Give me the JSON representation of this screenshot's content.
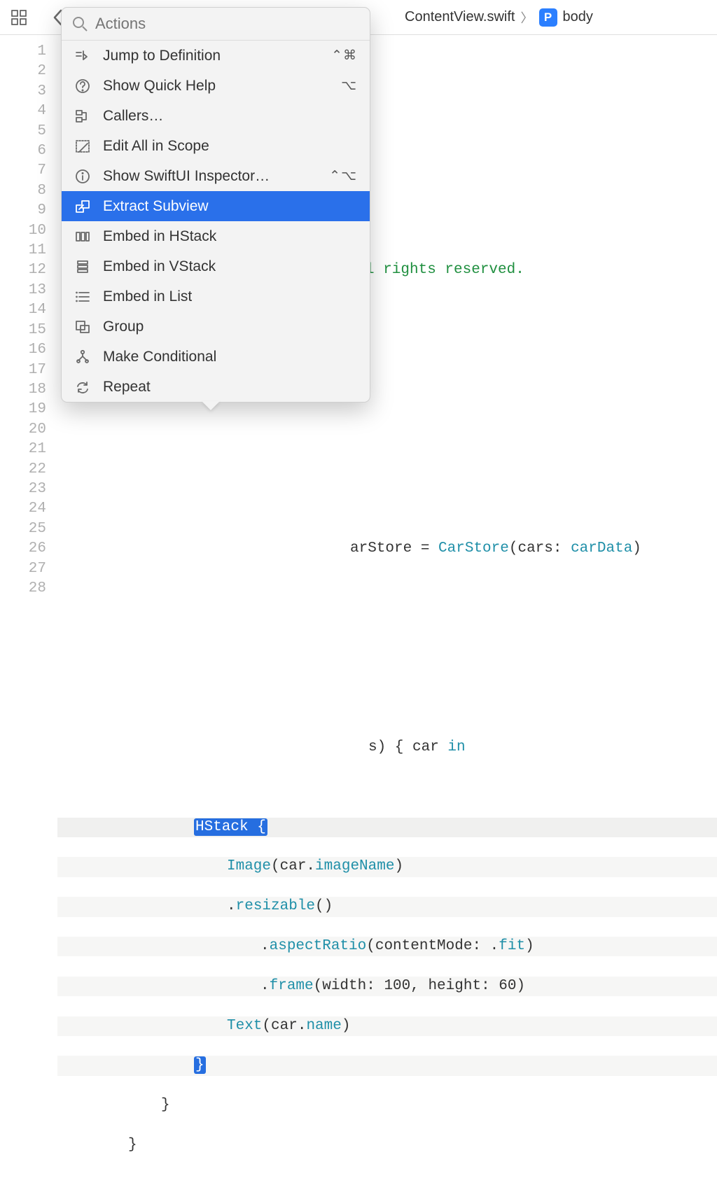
{
  "toolbar": {
    "breadcrumb_file": "ContentView.swift",
    "breadcrumb_symbol": "body",
    "p_icon_letter": "P"
  },
  "popup": {
    "search_placeholder": "Actions",
    "items": [
      {
        "label": "Jump to Definition",
        "shortcut": "⌃⌘",
        "icon": "jump-definition-icon"
      },
      {
        "label": "Show Quick Help",
        "shortcut": "⌥",
        "icon": "help-icon"
      },
      {
        "label": "Callers…",
        "shortcut": "",
        "icon": "callers-icon"
      },
      {
        "label": "Edit All in Scope",
        "shortcut": "",
        "icon": "edit-scope-icon"
      },
      {
        "label": "Show SwiftUI Inspector…",
        "shortcut": "⌃⌥",
        "icon": "info-icon"
      },
      {
        "label": "Extract Subview",
        "shortcut": "",
        "icon": "extract-icon",
        "selected": true
      },
      {
        "label": "Embed in HStack",
        "shortcut": "",
        "icon": "hstack-icon"
      },
      {
        "label": "Embed in VStack",
        "shortcut": "",
        "icon": "vstack-icon"
      },
      {
        "label": "Embed in List",
        "shortcut": "",
        "icon": "list-icon"
      },
      {
        "label": "Group",
        "shortcut": "",
        "icon": "group-icon"
      },
      {
        "label": "Make Conditional",
        "shortcut": "",
        "icon": "conditional-icon"
      },
      {
        "label": "Repeat",
        "shortcut": "",
        "icon": "repeat-icon"
      }
    ]
  },
  "gutter": {
    "start": 1,
    "end": 28
  },
  "code": {
    "line6": "l rights reserved.",
    "line13_prefix": "arStore = ",
    "line13_ctor": "CarStore",
    "line13_mid": "(cars: ",
    "line13_arg": "carData",
    "line13_end": ")",
    "line18_prefix": "s) { car ",
    "line18_in": "in",
    "line20_hstack": "HStack",
    "line20_brace": " {",
    "line21_image": "Image",
    "line21_mid": "(car.",
    "line21_prop": "imageName",
    "line21_end": ")",
    "line22_dot": ".",
    "line22_resizable": "resizable",
    "line22_end": "()",
    "line23_dot": ".",
    "line23_ar": "aspectRatio",
    "line23_mid": "(contentMode: .",
    "line23_fit": "fit",
    "line23_end": ")",
    "line24_dot": ".",
    "line24_frame": "frame",
    "line24_args": "(width: 100, height: 60)",
    "line25_text": "Text",
    "line25_mid": "(car.",
    "line25_prop": "name",
    "line25_end": ")",
    "line26_brace": "}",
    "line27_brace": "}",
    "line28_brace": "}"
  }
}
